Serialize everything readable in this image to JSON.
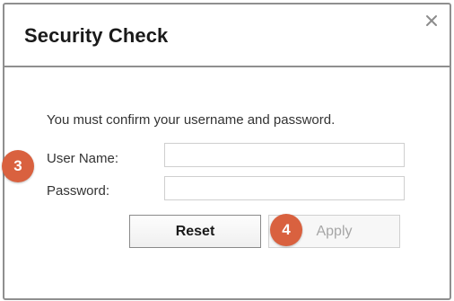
{
  "dialog": {
    "title": "Security Check",
    "close_icon": "close-icon",
    "message": "You must confirm your username and password.",
    "fields": {
      "username": {
        "label": "User Name:",
        "value": "",
        "placeholder": ""
      },
      "password": {
        "label": "Password:",
        "value": "",
        "placeholder": ""
      }
    },
    "buttons": {
      "reset": "Reset",
      "apply": "Apply"
    }
  },
  "annotations": {
    "badge_3": "3",
    "badge_4": "4"
  },
  "colors": {
    "badge": "#d9613f",
    "border": "#8f8f8f",
    "disabled_text": "#a6a6a6"
  }
}
